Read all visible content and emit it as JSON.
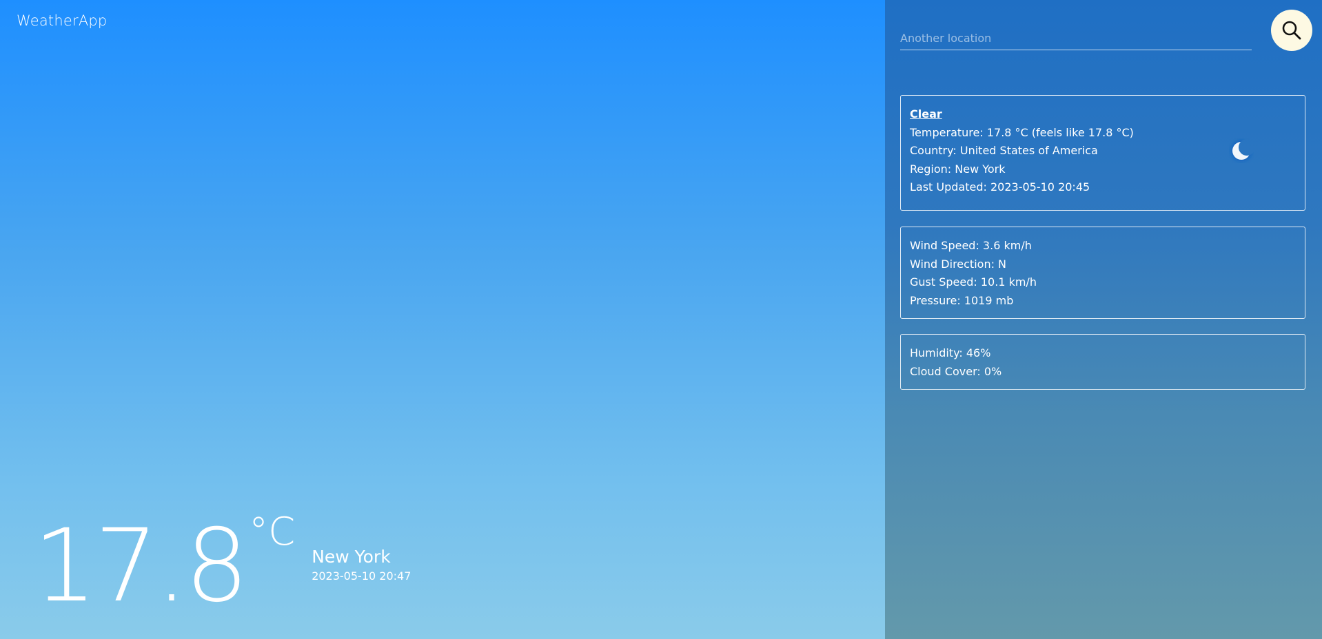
{
  "brand": {
    "name": "WeatherApp"
  },
  "hero": {
    "temperature": "17.8",
    "unit": "°C",
    "city": "New York",
    "local_time": "2023-05-10 20:47"
  },
  "search": {
    "placeholder": "Another location",
    "value": "",
    "icon": "search-icon"
  },
  "condition_card": {
    "title": "Clear",
    "icon": "moon-icon",
    "lines": [
      "Temperature: 17.8 °C (feels like 17.8 °C)",
      "Country: United States of America",
      "Region: New York",
      "Last Updated: 2023-05-10 20:45"
    ]
  },
  "wind_card": {
    "lines": [
      "Wind Speed: 3.6 km/h",
      "Wind Direction: N",
      "Gust Speed: 10.1 km/h",
      "Pressure: 1019 mb"
    ]
  },
  "humidity_card": {
    "lines": [
      "Humidity: 46%",
      "Cloud Cover: 0%"
    ]
  },
  "colors": {
    "main_top": "#1e8fff",
    "main_bottom": "#8acbea",
    "side_top": "#1f6fc4",
    "side_bottom": "#6399ab",
    "search_button_bg": "#fdf9e3",
    "moon_glow": "#1565c0"
  }
}
